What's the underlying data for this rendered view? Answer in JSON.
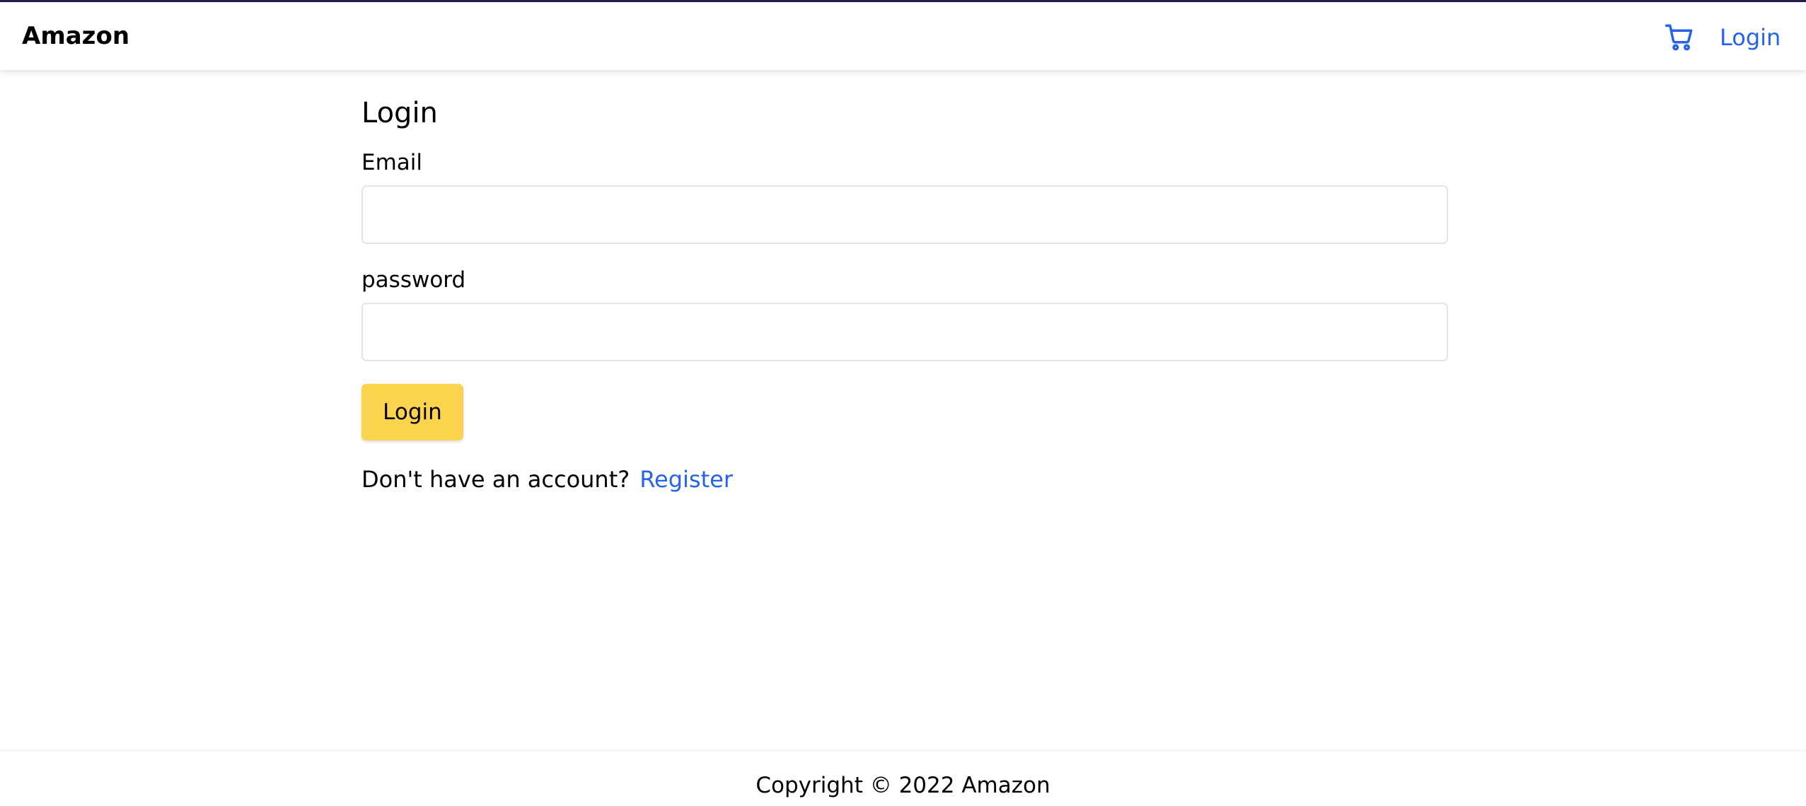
{
  "header": {
    "brand": "Amazon",
    "cart_icon": "shopping-cart-icon",
    "login_link": "Login"
  },
  "form": {
    "title": "Login",
    "email_label": "Email",
    "email_value": "",
    "password_label": "password",
    "password_value": "",
    "submit_label": "Login",
    "register_prompt": "Don't have an account?",
    "register_link": "Register"
  },
  "footer": {
    "copyright": "Copyright © 2022 Amazon"
  },
  "colors": {
    "accent_link": "#2563eb",
    "button_yellow": "#fcd34d",
    "top_strip": "#2a1f55"
  }
}
